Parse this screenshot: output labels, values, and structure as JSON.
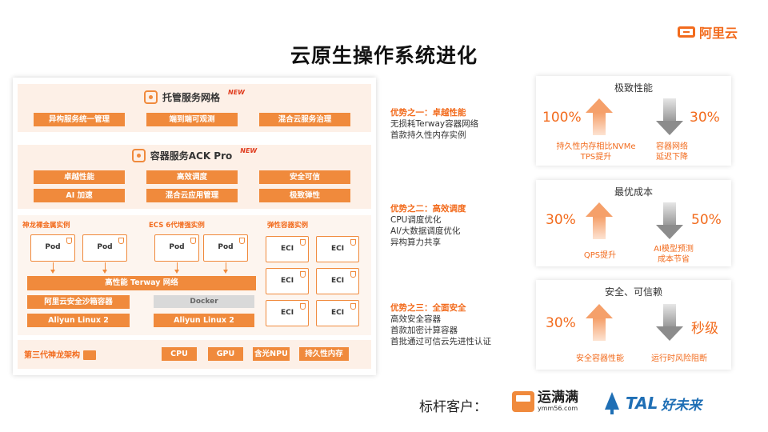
{
  "title": "云原生操作系统进化",
  "brand": {
    "name": "阿里云",
    "icon": "alibaba-cloud-logo-icon"
  },
  "arch": {
    "managed_mesh": {
      "title": "托管服务网格",
      "badge": "NEW",
      "items": [
        "异构服务统一管理",
        "端到端可观测",
        "混合云服务治理"
      ]
    },
    "ack_pro": {
      "title": "容器服务ACK Pro",
      "badge": "NEW",
      "items": [
        "卓越性能",
        "高效调度",
        "安全可信",
        "AI 加速",
        "混合云应用管理",
        "极致弹性"
      ]
    },
    "runtime": {
      "bare_metal": {
        "label": "神龙裸金属实例",
        "pods": [
          "Pod",
          "Pod"
        ],
        "sandbox": "阿里云安全沙箱容器",
        "os": "Aliyun Linux 2"
      },
      "ecs": {
        "label": "ECS 6代增强实例",
        "pods": [
          "Pod",
          "Pod"
        ],
        "docker": "Docker",
        "os": "Aliyun Linux 2"
      },
      "network": "高性能 Terway 网络",
      "eci": {
        "label": "弹性容器实例",
        "items": [
          "ECI",
          "ECI",
          "ECI",
          "ECI",
          "ECI",
          "ECI"
        ]
      }
    },
    "hardware": {
      "label": "第三代神龙架构",
      "items": [
        "CPU",
        "GPU",
        "含光NPU",
        "持久性内存"
      ]
    }
  },
  "advantages": [
    {
      "heading": "优势之一：卓越性能",
      "lines": [
        "无损耗Terway容器网络",
        "首款持久性内存实例"
      ]
    },
    {
      "heading": "优势之二：高效调度",
      "lines": [
        "CPU调度优化",
        "AI/大数据调度优化",
        "异构算力共享"
      ]
    },
    {
      "heading": "优势之三：全面安全",
      "lines": [
        "高效安全容器",
        "首款加密计算容器",
        "首批通过可信云先进性认证"
      ]
    }
  ],
  "cards": [
    {
      "title": "极致性能",
      "left_value": "100%",
      "left_caption": [
        "持久性内存相比NVMe",
        "TPS提升"
      ],
      "right_value": "30%",
      "right_caption": [
        "容器网络",
        "延迟下降"
      ]
    },
    {
      "title": "最优成本",
      "left_value": "30%",
      "left_caption": [
        "QPS提升"
      ],
      "right_value": "50%",
      "right_caption": [
        "AI模型预测",
        "成本节省"
      ]
    },
    {
      "title": "安全、可信赖",
      "left_value": "30%",
      "left_caption": [
        "安全容器性能"
      ],
      "right_value": "秒级",
      "right_caption": [
        "运行时风险阻断"
      ]
    }
  ],
  "customers": {
    "label": "标杆客户：",
    "ymm": {
      "name": "运满满",
      "url": "ymm56.com"
    },
    "tal": {
      "name": "TAL",
      "cn": "好未来"
    }
  },
  "colors": {
    "accent": "#f26b1d",
    "button": "#f08a3c",
    "band": "#fdf0e7",
    "tal_blue": "#1f6fb5"
  }
}
